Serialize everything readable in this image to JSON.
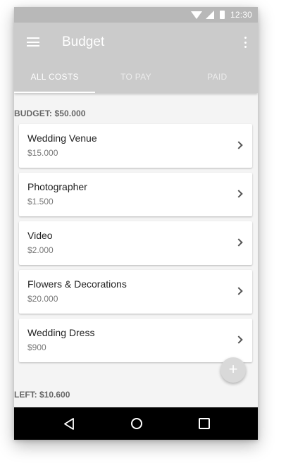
{
  "status_bar": {
    "time": "12:30"
  },
  "app_bar": {
    "title": "Budget"
  },
  "tabs": [
    {
      "label": "ALL COSTS",
      "active": true
    },
    {
      "label": "TO PAY",
      "active": false
    },
    {
      "label": "PAID",
      "active": false
    }
  ],
  "summary": {
    "budget": "BUDGET: $50.000",
    "left": "LEFT: $10.600"
  },
  "costs": [
    {
      "name": "Wedding Venue",
      "amount": "$15.000"
    },
    {
      "name": "Photographer",
      "amount": "$1.500"
    },
    {
      "name": "Video",
      "amount": "$2.000"
    },
    {
      "name": "Flowers & Decorations",
      "amount": "$20.000"
    },
    {
      "name": "Wedding Dress",
      "amount": "$900"
    }
  ],
  "fab": {
    "icon": "plus-icon",
    "label": "+"
  },
  "colors": {
    "app_bar": "#cbcbcb",
    "status_bar": "#b8b8b8",
    "background": "#f4f4f4",
    "nav_bar": "#000000"
  }
}
